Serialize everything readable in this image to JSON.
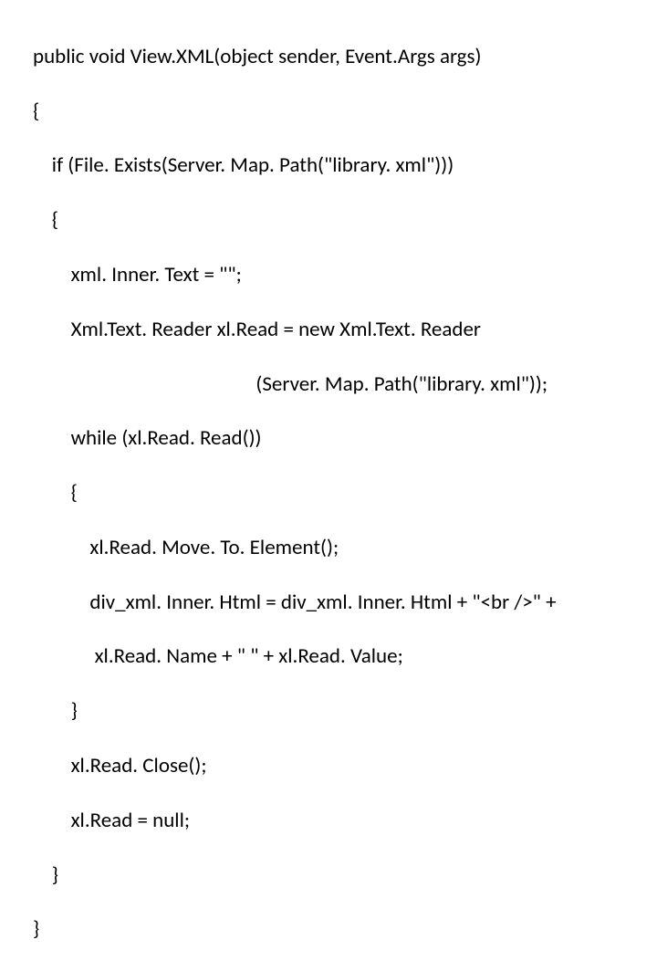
{
  "code": {
    "l01": "public void View.XML(object sender, Event.Args args)",
    "l02": "{",
    "l03": "    if (File. Exists(Server. Map. Path(\"library. xml\")))",
    "l04": "    {",
    "l05": "        xml. Inner. Text = \"\";",
    "l06": "        Xml.Text. Reader xl.Read = new Xml.Text. Reader",
    "l07": "                                               (Server. Map. Path(\"library. xml\"));",
    "l08": "        while (xl.Read. Read())",
    "l09": "        {",
    "l10": "            xl.Read. Move. To. Element();",
    "l11": "            div_xml. Inner. Html = div_xml. Inner. Html + \"<br />\" +",
    "l12": "             xl.Read. Name + \" \" + xl.Read. Value;",
    "l13": "        }",
    "l14": "        xl.Read. Close();",
    "l15": "        xl.Read = null;",
    "l16": "    }",
    "l17": "}"
  }
}
